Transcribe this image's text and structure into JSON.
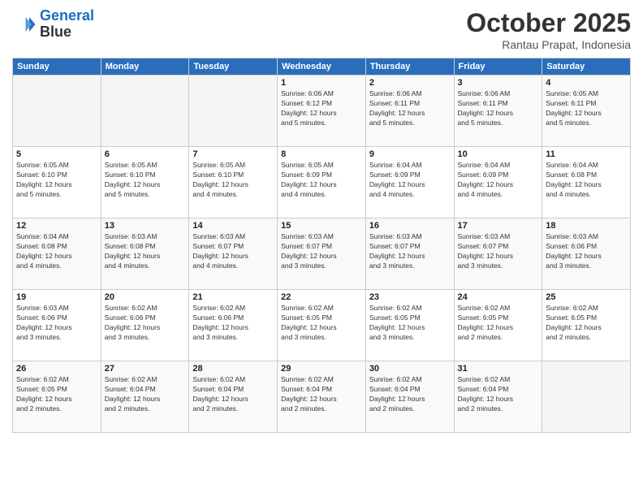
{
  "header": {
    "logo_line1": "General",
    "logo_line2": "Blue",
    "month": "October 2025",
    "location": "Rantau Prapat, Indonesia"
  },
  "weekdays": [
    "Sunday",
    "Monday",
    "Tuesday",
    "Wednesday",
    "Thursday",
    "Friday",
    "Saturday"
  ],
  "weeks": [
    [
      {
        "day": "",
        "info": ""
      },
      {
        "day": "",
        "info": ""
      },
      {
        "day": "",
        "info": ""
      },
      {
        "day": "1",
        "info": "Sunrise: 6:06 AM\nSunset: 6:12 PM\nDaylight: 12 hours\nand 5 minutes."
      },
      {
        "day": "2",
        "info": "Sunrise: 6:06 AM\nSunset: 6:11 PM\nDaylight: 12 hours\nand 5 minutes."
      },
      {
        "day": "3",
        "info": "Sunrise: 6:06 AM\nSunset: 6:11 PM\nDaylight: 12 hours\nand 5 minutes."
      },
      {
        "day": "4",
        "info": "Sunrise: 6:05 AM\nSunset: 6:11 PM\nDaylight: 12 hours\nand 5 minutes."
      }
    ],
    [
      {
        "day": "5",
        "info": "Sunrise: 6:05 AM\nSunset: 6:10 PM\nDaylight: 12 hours\nand 5 minutes."
      },
      {
        "day": "6",
        "info": "Sunrise: 6:05 AM\nSunset: 6:10 PM\nDaylight: 12 hours\nand 5 minutes."
      },
      {
        "day": "7",
        "info": "Sunrise: 6:05 AM\nSunset: 6:10 PM\nDaylight: 12 hours\nand 4 minutes."
      },
      {
        "day": "8",
        "info": "Sunrise: 6:05 AM\nSunset: 6:09 PM\nDaylight: 12 hours\nand 4 minutes."
      },
      {
        "day": "9",
        "info": "Sunrise: 6:04 AM\nSunset: 6:09 PM\nDaylight: 12 hours\nand 4 minutes."
      },
      {
        "day": "10",
        "info": "Sunrise: 6:04 AM\nSunset: 6:09 PM\nDaylight: 12 hours\nand 4 minutes."
      },
      {
        "day": "11",
        "info": "Sunrise: 6:04 AM\nSunset: 6:08 PM\nDaylight: 12 hours\nand 4 minutes."
      }
    ],
    [
      {
        "day": "12",
        "info": "Sunrise: 6:04 AM\nSunset: 6:08 PM\nDaylight: 12 hours\nand 4 minutes."
      },
      {
        "day": "13",
        "info": "Sunrise: 6:03 AM\nSunset: 6:08 PM\nDaylight: 12 hours\nand 4 minutes."
      },
      {
        "day": "14",
        "info": "Sunrise: 6:03 AM\nSunset: 6:07 PM\nDaylight: 12 hours\nand 4 minutes."
      },
      {
        "day": "15",
        "info": "Sunrise: 6:03 AM\nSunset: 6:07 PM\nDaylight: 12 hours\nand 3 minutes."
      },
      {
        "day": "16",
        "info": "Sunrise: 6:03 AM\nSunset: 6:07 PM\nDaylight: 12 hours\nand 3 minutes."
      },
      {
        "day": "17",
        "info": "Sunrise: 6:03 AM\nSunset: 6:07 PM\nDaylight: 12 hours\nand 3 minutes."
      },
      {
        "day": "18",
        "info": "Sunrise: 6:03 AM\nSunset: 6:06 PM\nDaylight: 12 hours\nand 3 minutes."
      }
    ],
    [
      {
        "day": "19",
        "info": "Sunrise: 6:03 AM\nSunset: 6:06 PM\nDaylight: 12 hours\nand 3 minutes."
      },
      {
        "day": "20",
        "info": "Sunrise: 6:02 AM\nSunset: 6:06 PM\nDaylight: 12 hours\nand 3 minutes."
      },
      {
        "day": "21",
        "info": "Sunrise: 6:02 AM\nSunset: 6:06 PM\nDaylight: 12 hours\nand 3 minutes."
      },
      {
        "day": "22",
        "info": "Sunrise: 6:02 AM\nSunset: 6:05 PM\nDaylight: 12 hours\nand 3 minutes."
      },
      {
        "day": "23",
        "info": "Sunrise: 6:02 AM\nSunset: 6:05 PM\nDaylight: 12 hours\nand 3 minutes."
      },
      {
        "day": "24",
        "info": "Sunrise: 6:02 AM\nSunset: 6:05 PM\nDaylight: 12 hours\nand 2 minutes."
      },
      {
        "day": "25",
        "info": "Sunrise: 6:02 AM\nSunset: 6:05 PM\nDaylight: 12 hours\nand 2 minutes."
      }
    ],
    [
      {
        "day": "26",
        "info": "Sunrise: 6:02 AM\nSunset: 6:05 PM\nDaylight: 12 hours\nand 2 minutes."
      },
      {
        "day": "27",
        "info": "Sunrise: 6:02 AM\nSunset: 6:04 PM\nDaylight: 12 hours\nand 2 minutes."
      },
      {
        "day": "28",
        "info": "Sunrise: 6:02 AM\nSunset: 6:04 PM\nDaylight: 12 hours\nand 2 minutes."
      },
      {
        "day": "29",
        "info": "Sunrise: 6:02 AM\nSunset: 6:04 PM\nDaylight: 12 hours\nand 2 minutes."
      },
      {
        "day": "30",
        "info": "Sunrise: 6:02 AM\nSunset: 6:04 PM\nDaylight: 12 hours\nand 2 minutes."
      },
      {
        "day": "31",
        "info": "Sunrise: 6:02 AM\nSunset: 6:04 PM\nDaylight: 12 hours\nand 2 minutes."
      },
      {
        "day": "",
        "info": ""
      }
    ]
  ]
}
